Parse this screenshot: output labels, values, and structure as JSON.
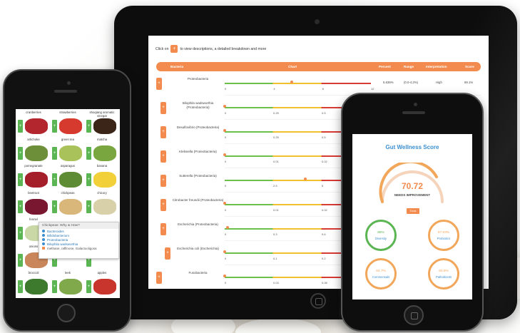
{
  "tablet": {
    "instruction_pre": "Click on",
    "instruction_plus": "+",
    "instruction_post": "to view descriptions, a detailed breakdown and more",
    "headers": {
      "bacteria": "Bacteria",
      "chart": "Chart",
      "percent": "Percent",
      "range": "Range",
      "interpretation": "Interpretation",
      "score": "Score"
    },
    "rows": [
      {
        "name": "Proteobacteria",
        "ticks": [
          "0",
          "4",
          "8",
          "12"
        ],
        "percent": "5.636%",
        "range": "(0.0-4.2%)",
        "interpretation": "High",
        "score": "69.1%",
        "marker": 0.46
      },
      {
        "name": "Bilophila wadsworthia (Proteobacteria)",
        "ticks": [
          "0",
          "0.25",
          "0.5"
        ],
        "marker": 0.0
      },
      {
        "name": "Desulfovibrio (Proteobacteria)",
        "ticks": [
          "0",
          "0.25",
          "0.5"
        ],
        "marker": 0.0
      },
      {
        "name": "Klebsiella (Proteobacteria)",
        "ticks": [
          "0",
          "0.01",
          "0.02"
        ],
        "marker": 0.0
      },
      {
        "name": "Sutterella (Proteobacteria)",
        "ticks": [
          "0",
          "2.5",
          "5"
        ],
        "marker": 0.55
      },
      {
        "name": "Citrobacter freundii (Proteobacteria)",
        "ticks": [
          "0",
          "0.01",
          "0.02"
        ],
        "marker": 0.0
      },
      {
        "name": "Escherichia (Proteobacteria)",
        "ticks": [
          "0",
          "0.3",
          "0.6"
        ],
        "marker": 0.02
      },
      {
        "name": "Escherichia coli (Escherichia)",
        "ticks": [
          "0",
          "0.1",
          "0.2"
        ],
        "marker": 0.0
      },
      {
        "name": "Fusobacteria",
        "ticks": [
          "0",
          "0.03",
          "0.06"
        ],
        "marker": 0.0
      }
    ]
  },
  "left_phone": {
    "foods": [
      {
        "label": "cranberries",
        "color": "#b3262e"
      },
      {
        "label": "strawberries",
        "color": "#d63a2f"
      },
      {
        "label": "shoqiang aromatic vinegar",
        "color": "#3b2418"
      },
      {
        "label": "artichoke",
        "color": "#6e8f3a"
      },
      {
        "label": "green tea",
        "color": "#a9c25a"
      },
      {
        "label": "matcha",
        "color": "#7aa640"
      },
      {
        "label": "pomegranate",
        "color": "#a51f2b"
      },
      {
        "label": "asparagus",
        "color": "#5d8c34"
      },
      {
        "label": "banana",
        "color": "#f1d03a"
      },
      {
        "label": "beetroot",
        "color": "#7a1730"
      },
      {
        "label": "chickpeas",
        "color": "#d9b77a"
      },
      {
        "label": "chicory",
        "color": "#d8d0a8"
      },
      {
        "label": "fennel",
        "color": "#c9d8a6"
      },
      {
        "label": "",
        "color": "#ffffff"
      },
      {
        "label": "",
        "color": "#ffffff"
      },
      {
        "label": "onions",
        "color": "#c9865a"
      },
      {
        "label": "",
        "color": "#ffffff"
      },
      {
        "label": "",
        "color": "#ffffff"
      },
      {
        "label": "broccoli",
        "color": "#3e7a2e"
      },
      {
        "label": "leek",
        "color": "#7fa94a"
      },
      {
        "label": "apples",
        "color": "#c8352c"
      }
    ],
    "popup": {
      "title": "Chickpeas: Why & How?",
      "links": [
        "Bacteroides",
        "Bifidobacterium",
        "Proteobacteria",
        "Bilophila wadsworthia"
      ],
      "note": "methane, raffinose, Galactooligosa"
    }
  },
  "right_phone": {
    "title": "Gut Wellness Score",
    "score": "70.72",
    "status": "NEEDS IMPROVEMENT",
    "tools_label": "Tools",
    "metrics": [
      {
        "value": "86%",
        "label": "Diversity",
        "color": "#5ab552"
      },
      {
        "value": "67.03%",
        "label": "Probiotics",
        "color": "#f2a65a"
      },
      {
        "value": "64.7%",
        "label": "Commensals",
        "color": "#f2a65a"
      },
      {
        "value": "60.6%",
        "label": "Pathobionts",
        "color": "#f2a65a"
      }
    ]
  },
  "colors": {
    "accent": "#f28b4d",
    "blue": "#3a8fd0",
    "green": "#5ab552",
    "yellow": "#f2c12e",
    "red": "#d83a34"
  }
}
